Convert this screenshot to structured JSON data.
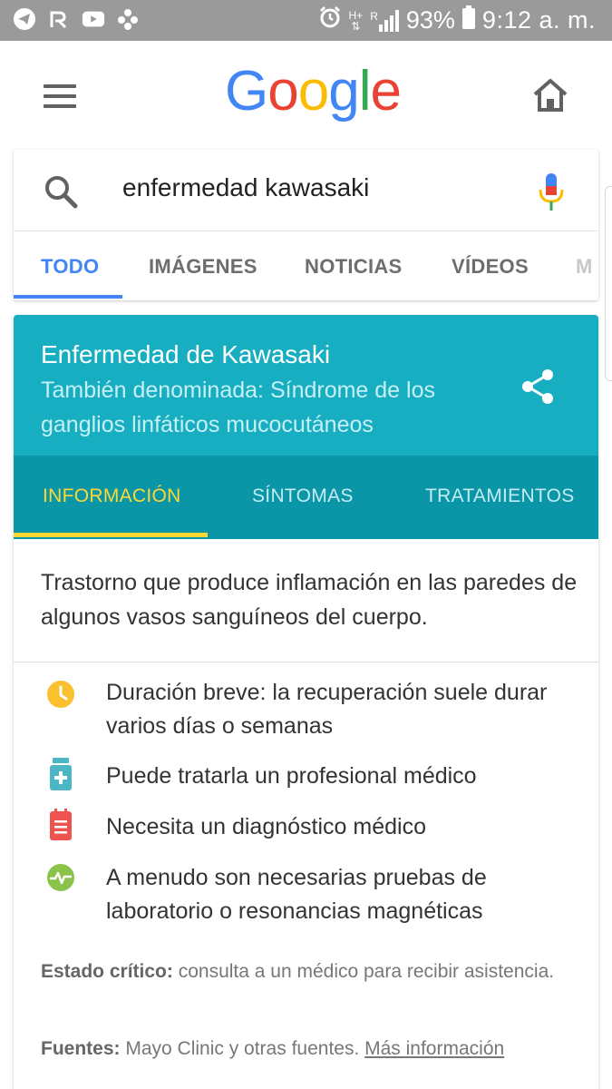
{
  "status_bar": {
    "battery": "93%",
    "time": "9:12 a. m.",
    "network": "H+",
    "roaming": "R",
    "icons": [
      "telegram-icon",
      "signal-app-icon",
      "youtube-icon",
      "game-controller-icon",
      "alarm-icon",
      "signal-strength-icon",
      "battery-icon"
    ]
  },
  "header": {
    "logo_letters": [
      {
        "ch": "G",
        "color": "#4285f4"
      },
      {
        "ch": "o",
        "color": "#ea4335"
      },
      {
        "ch": "o",
        "color": "#fbbc05"
      },
      {
        "ch": "g",
        "color": "#4285f4"
      },
      {
        "ch": "l",
        "color": "#34a853"
      },
      {
        "ch": "e",
        "color": "#ea4335"
      }
    ]
  },
  "search": {
    "query": "enfermedad kawasaki",
    "tabs": [
      "TODO",
      "IMÁGENES",
      "NOTICIAS",
      "VÍDEOS",
      "M"
    ]
  },
  "knowledge_panel": {
    "title": "Enfermedad de Kawasaki",
    "subtitle": "También denominada: Síndrome de los ganglios linfáticos mucocutáneos",
    "tabs": [
      "INFORMACIÓN",
      "SÍNTOMAS",
      "TRATAMIENTOS"
    ],
    "description": "Trastorno que produce inflamación en las paredes de algunos vasos sanguíneos del cuerpo.",
    "facts": [
      {
        "icon": "clock-icon",
        "color": "#fbc02d",
        "text": "Duración breve: la recuperación suele durar varios días o semanas"
      },
      {
        "icon": "medicine-bottle-icon",
        "color": "#4db6c4",
        "text": "Puede tratarla un profesional médico"
      },
      {
        "icon": "clipboard-icon",
        "color": "#ef5350",
        "text": "Necesita un diagnóstico médico"
      },
      {
        "icon": "pulse-icon",
        "color": "#8bc34a",
        "text": "A menudo son necesarias pruebas de laboratorio o resonancias magnéticas"
      }
    ],
    "critical_label": "Estado crítico:",
    "critical_text": " consulta a un médico para recibir asistencia.",
    "sources_label": "Fuentes:",
    "sources_text": " Mayo Clinic y otras fuentes. ",
    "more_info": "Más información"
  },
  "colors": {
    "header_teal": "#17aec2",
    "tabs_teal": "#0b96a8",
    "active_yellow": "#fdd835",
    "google_blue": "#4285f4"
  }
}
